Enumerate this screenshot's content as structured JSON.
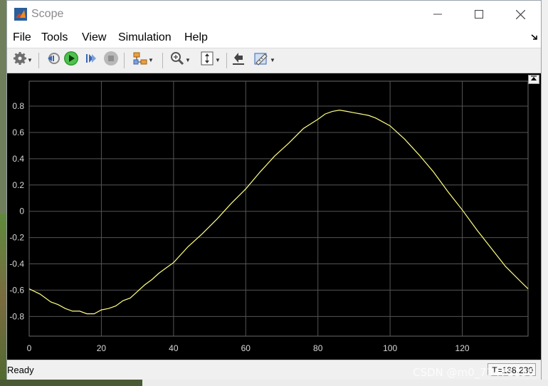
{
  "window": {
    "title": "Scope"
  },
  "menu": {
    "items": [
      "File",
      "Tools",
      "View",
      "Simulation",
      "Help"
    ]
  },
  "toolbar": {
    "icons": [
      "gear-icon",
      "step-back-icon",
      "run-icon",
      "step-forward-icon",
      "stop-icon",
      "highlight-block-icon",
      "zoom-icon",
      "fit-axes-icon",
      "restore-layout-icon",
      "measure-icon"
    ]
  },
  "status": {
    "text": "Ready",
    "time": "T=138.230"
  },
  "watermark": "CSDN @m0_73471136",
  "chart_data": {
    "type": "line",
    "title": "",
    "xlabel": "",
    "ylabel": "",
    "xlim": [
      0,
      138.23
    ],
    "ylim": [
      -0.95,
      0.99
    ],
    "xticks": [
      0,
      20,
      40,
      60,
      80,
      100,
      120
    ],
    "yticks": [
      -0.8,
      -0.6,
      -0.4,
      -0.2,
      0,
      0.2,
      0.4,
      0.6,
      0.8
    ],
    "ytick_labels": [
      "-0.8",
      "-0.6",
      "-0.4",
      "-0.2",
      "0",
      "0.2",
      "0.4",
      "0.6",
      "0.8"
    ],
    "grid": true,
    "line_color": "#ffff80",
    "series": [
      {
        "x": [
          0,
          3,
          6,
          8,
          10,
          12,
          14,
          16,
          18,
          20,
          22,
          24,
          26,
          28,
          30,
          32,
          34,
          36,
          38,
          40,
          44,
          48,
          52,
          56,
          60,
          64,
          68,
          72,
          76,
          80,
          82,
          84,
          86,
          88,
          90,
          92,
          94,
          96,
          100,
          104,
          108,
          112,
          116,
          120,
          124,
          128,
          132,
          136,
          138.23
        ],
        "y": [
          -0.59,
          -0.63,
          -0.69,
          -0.71,
          -0.74,
          -0.76,
          -0.76,
          -0.78,
          -0.78,
          -0.75,
          -0.74,
          -0.72,
          -0.68,
          -0.66,
          -0.61,
          -0.56,
          -0.52,
          -0.47,
          -0.43,
          -0.39,
          -0.27,
          -0.17,
          -0.06,
          0.06,
          0.17,
          0.3,
          0.42,
          0.52,
          0.63,
          0.7,
          0.74,
          0.76,
          0.77,
          0.76,
          0.75,
          0.74,
          0.73,
          0.71,
          0.65,
          0.55,
          0.43,
          0.3,
          0.15,
          0.01,
          -0.14,
          -0.28,
          -0.42,
          -0.53,
          -0.59
        ]
      }
    ]
  }
}
